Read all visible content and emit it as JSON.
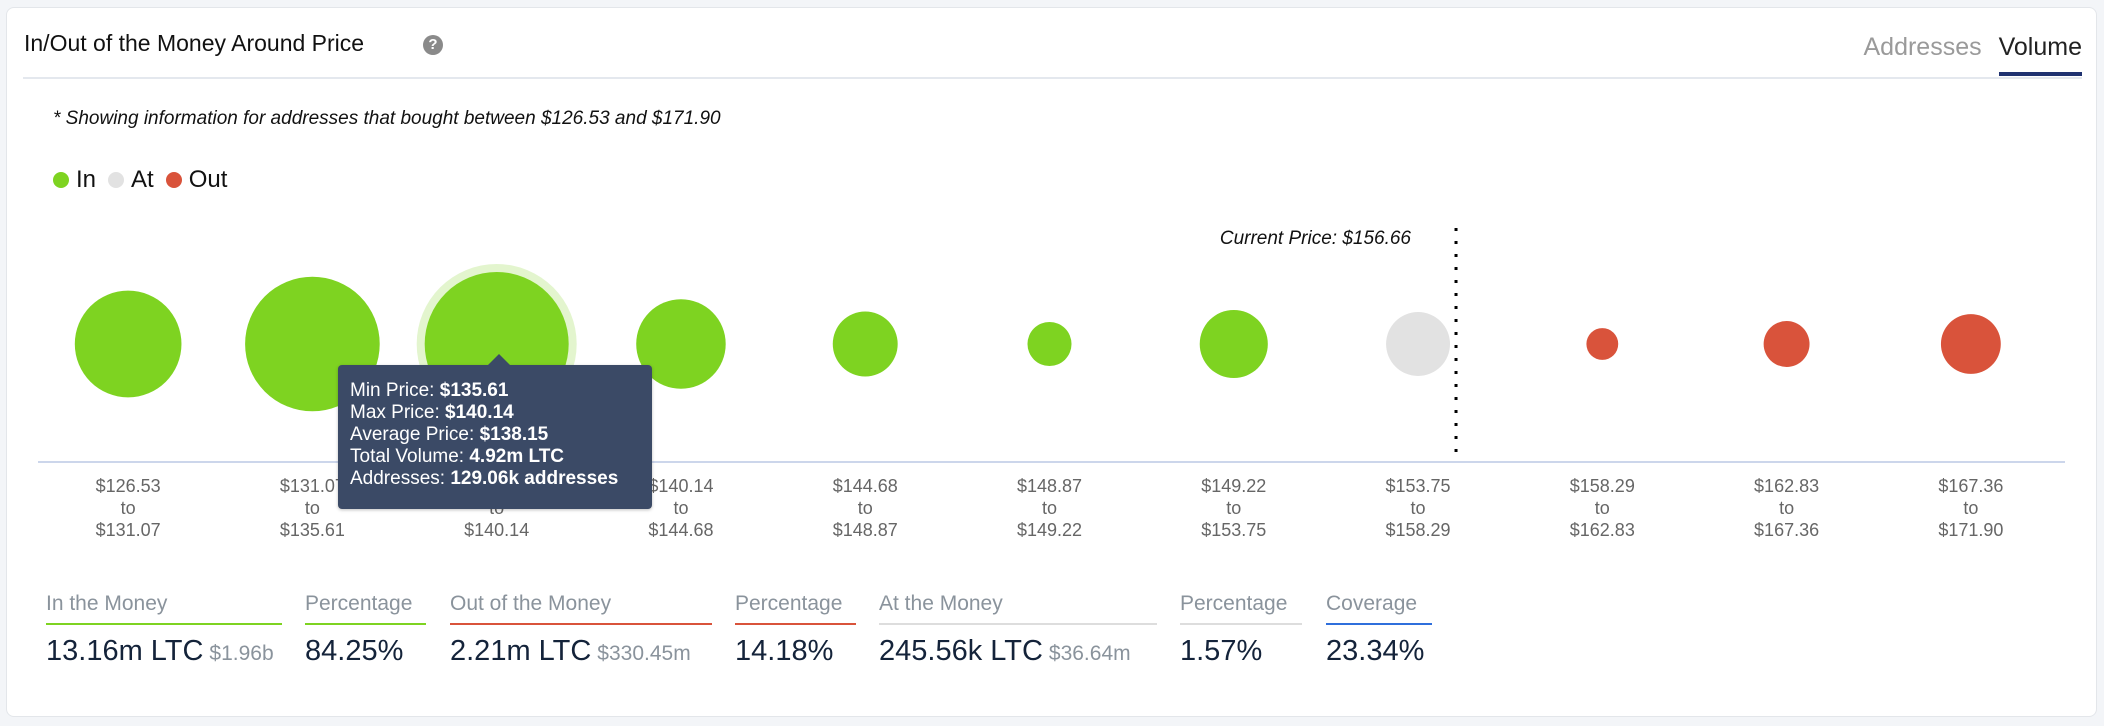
{
  "header": {
    "title": "In/Out of the Money Around Price",
    "help_icon": "question-circle-icon",
    "tabs": [
      {
        "label": "Addresses",
        "active": false
      },
      {
        "label": "Volume",
        "active": true
      }
    ]
  },
  "note": "* Showing information for addresses that bought between $126.53 and $171.90",
  "colors": {
    "in": "#7ed321",
    "at": "#e2e2e2",
    "out": "#d9533b",
    "tab_active": "#1f3270",
    "coverage": "#2f6fdc",
    "tooltip_bg": "#3b4a66"
  },
  "chart_data": {
    "type": "bubble",
    "title": "In/Out of the Money Around Price",
    "legend": {
      "position": "top-left",
      "entries": [
        "In",
        "At",
        "Out"
      ]
    },
    "current_price_label": "Current Price: $156.66",
    "current_price": 156.66,
    "size_metric": "Total Volume (LTC, estimated from bubble size except highlighted bin)",
    "bins": [
      {
        "min": "$126.53",
        "max": "$131.07",
        "status": "in",
        "volume_m_ltc": 2.7
      },
      {
        "min": "$131.07",
        "max": "$135.61",
        "status": "in",
        "volume_m_ltc": 4.3
      },
      {
        "min": "$135.61",
        "max": "$140.14",
        "status": "in",
        "volume_m_ltc": 4.92,
        "highlighted": true
      },
      {
        "min": "$140.14",
        "max": "$144.68",
        "status": "in",
        "volume_m_ltc": 1.9
      },
      {
        "min": "$144.68",
        "max": "$148.87",
        "status": "in",
        "volume_m_ltc": 1.0
      },
      {
        "min": "$148.87",
        "max": "$149.22",
        "status": "in",
        "volume_m_ltc": 0.46
      },
      {
        "min": "$149.22",
        "max": "$153.75",
        "status": "in",
        "volume_m_ltc": 1.1
      },
      {
        "min": "$153.75",
        "max": "$158.29",
        "status": "at",
        "volume_m_ltc": 0.97
      },
      {
        "min": "$158.29",
        "max": "$162.83",
        "status": "out",
        "volume_m_ltc": 0.24
      },
      {
        "min": "$162.83",
        "max": "$167.36",
        "status": "out",
        "volume_m_ltc": 0.5
      },
      {
        "min": "$167.36",
        "max": "$171.90",
        "status": "out",
        "volume_m_ltc": 0.85
      }
    ],
    "x_connector": "to"
  },
  "tooltip": {
    "rows": [
      {
        "label": "Min Price: ",
        "value": "$135.61"
      },
      {
        "label": "Max Price: ",
        "value": "$140.14"
      },
      {
        "label": "Average Price: ",
        "value": "$138.15"
      },
      {
        "label": "Total Volume: ",
        "value": "4.92m LTC"
      },
      {
        "label": "Addresses: ",
        "value": "129.06k addresses"
      }
    ]
  },
  "stats": [
    {
      "label": "In the Money",
      "value": "13.16m LTC",
      "sub": "$1.96b",
      "color": "#7ed321"
    },
    {
      "label": "Percentage",
      "value": "84.25%",
      "sub": "",
      "color": "#7ed321"
    },
    {
      "label": "Out of the Money",
      "value": "2.21m LTC",
      "sub": "$330.45m",
      "color": "#d9533b"
    },
    {
      "label": "Percentage",
      "value": "14.18%",
      "sub": "",
      "color": "#d9533b"
    },
    {
      "label": "At the Money",
      "value": "245.56k LTC",
      "sub": "$36.64m",
      "color": "#dddddd"
    },
    {
      "label": "Percentage",
      "value": "1.57%",
      "sub": "",
      "color": "#dddddd"
    },
    {
      "label": "Coverage",
      "value": "23.34%",
      "sub": "",
      "color": "#2f6fdc"
    }
  ]
}
